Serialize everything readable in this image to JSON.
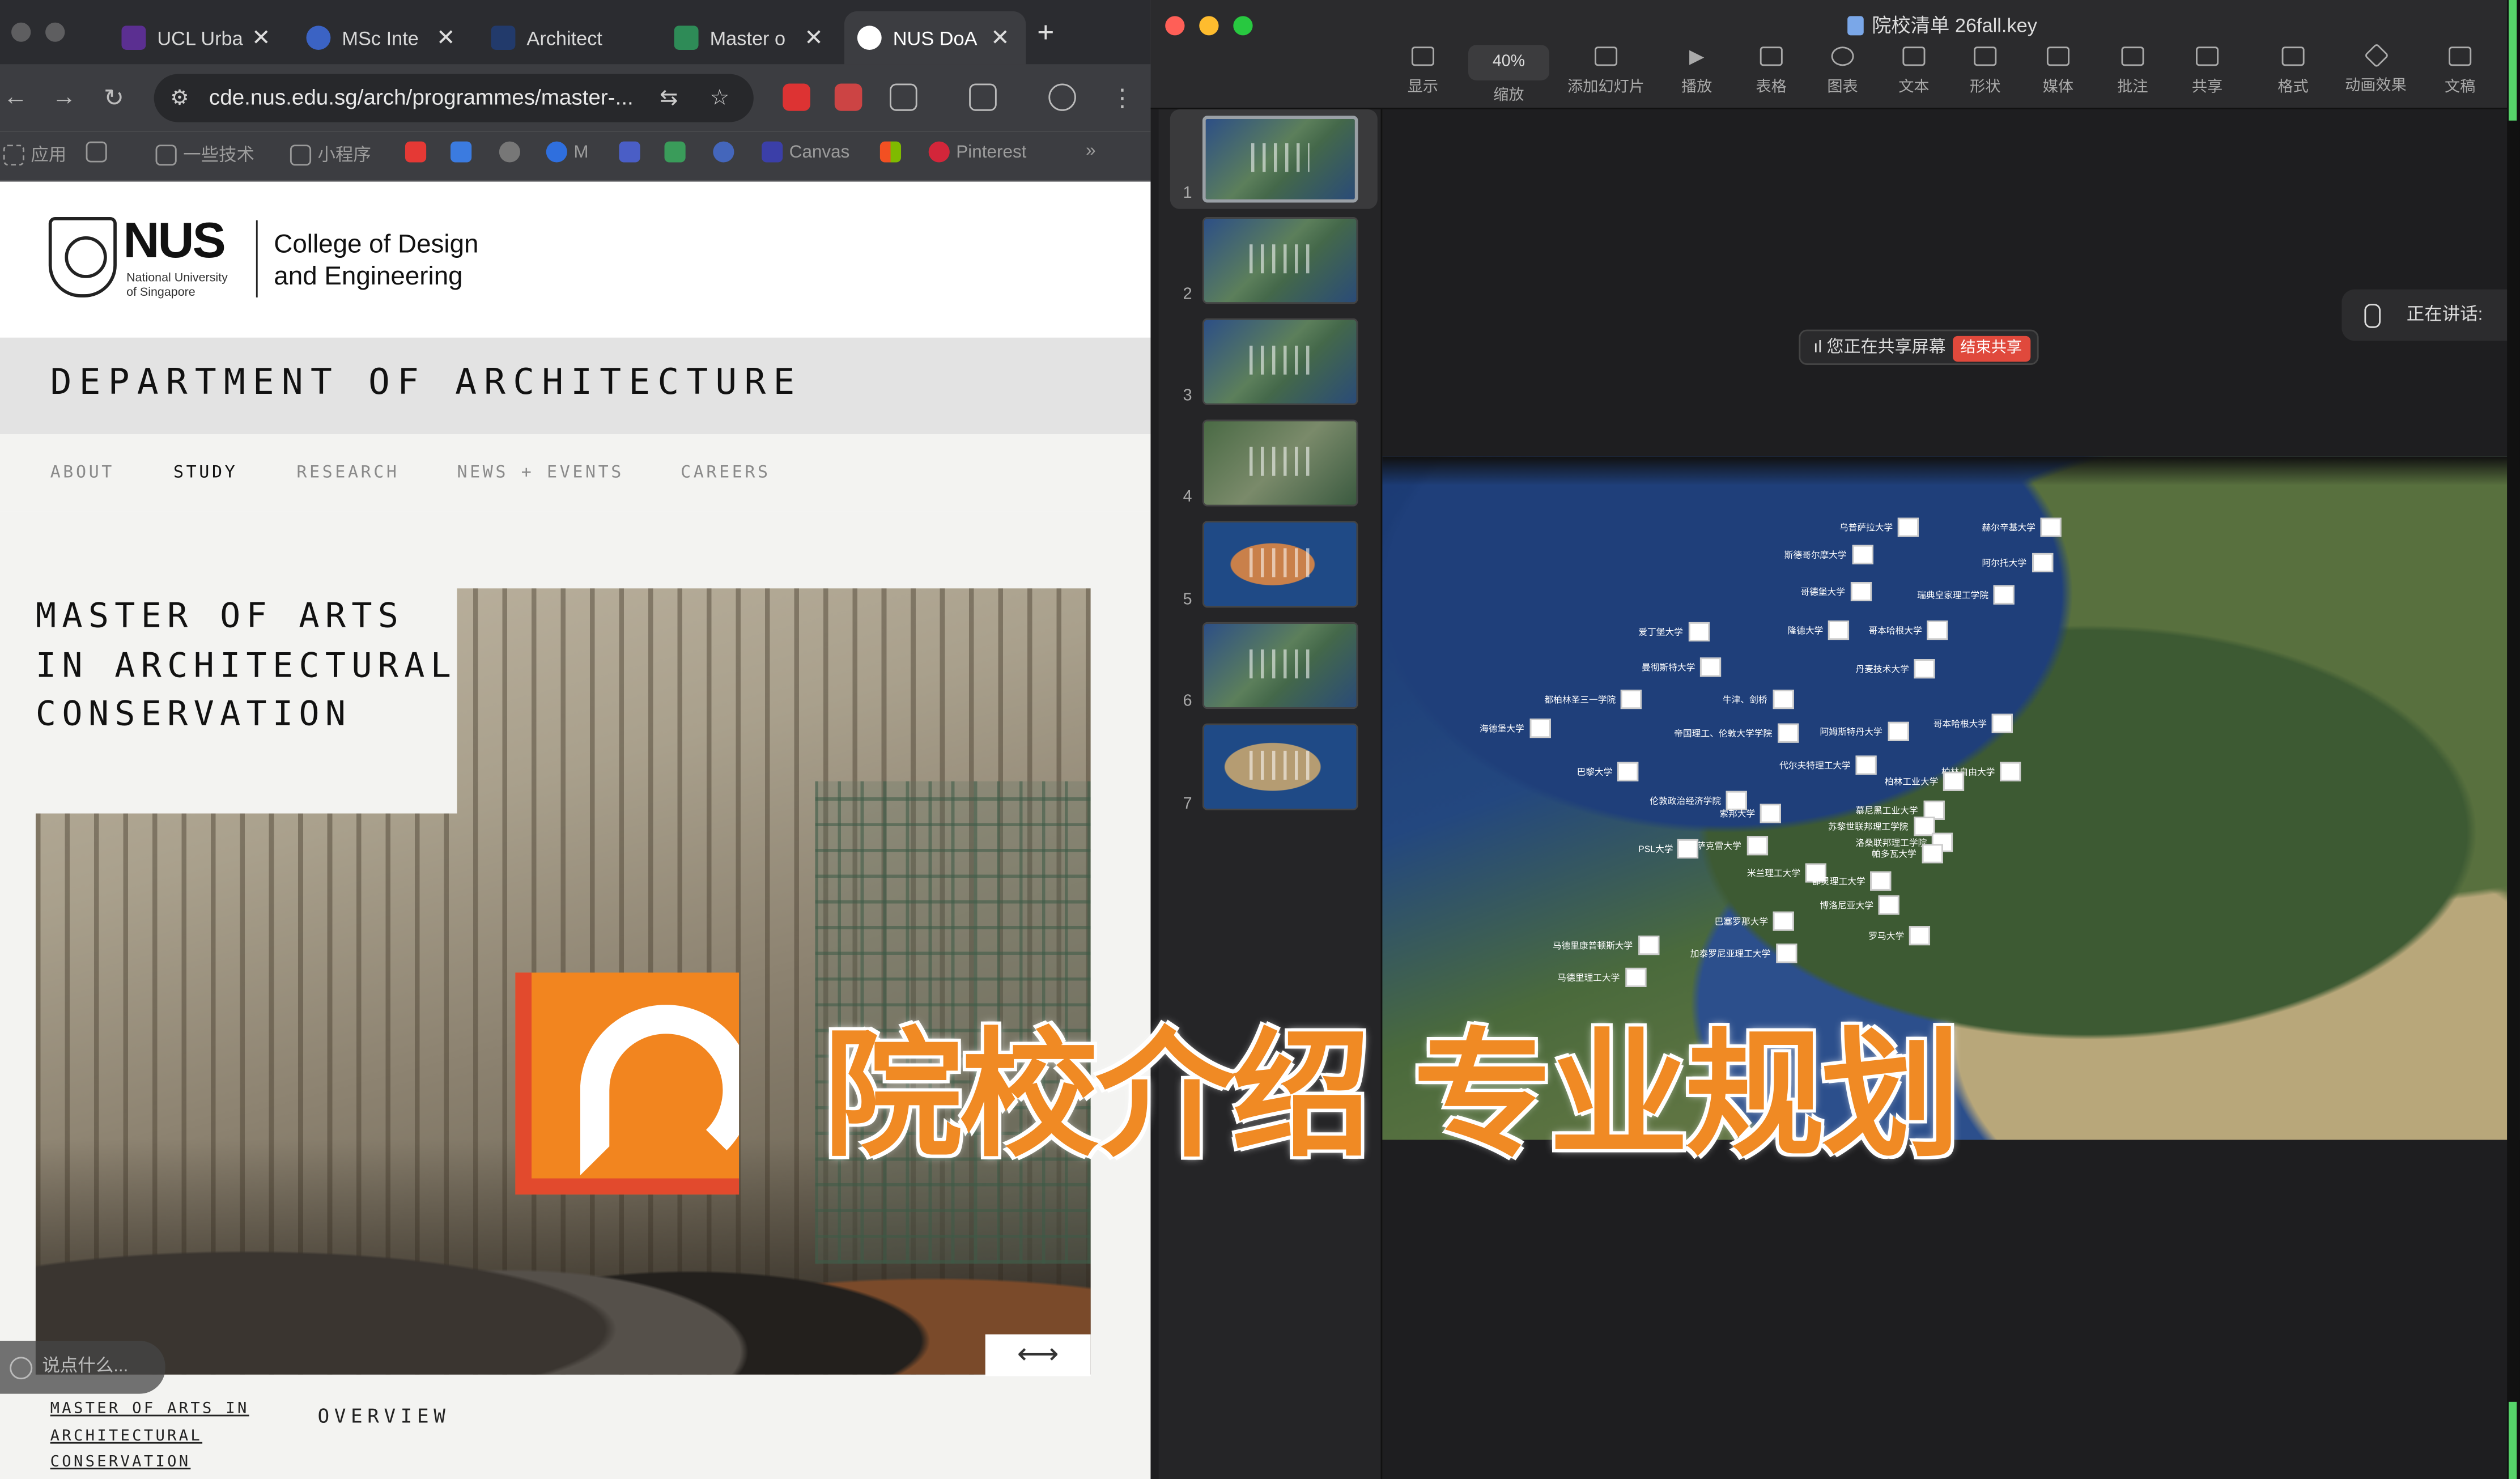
{
  "browser": {
    "tabs": [
      {
        "label": "UCL Urba",
        "close": "✕"
      },
      {
        "label": "MSc Inte",
        "close": "✕"
      },
      {
        "label": "Architect",
        "close": ""
      },
      {
        "label": "Master o",
        "close": "✕"
      },
      {
        "label": "NUS DoA",
        "close": "✕"
      }
    ],
    "new_tab": "+",
    "url": "cde.nus.edu.sg/arch/programmes/master-...",
    "bookmarks": [
      "应用",
      "一些技术",
      "小程序",
      "M",
      "Canvas",
      "Pinterest"
    ]
  },
  "site": {
    "logo_text": "NUS",
    "logo_sub": "National University of Singapore",
    "college_line1": "College of Design",
    "college_line2": "and Engineering",
    "department": "DEPARTMENT OF ARCHITECTURE",
    "menu": [
      "ABOUT",
      "STUDY",
      "RESEARCH",
      "NEWS + EVENTS",
      "CAREERS"
    ],
    "menu_active": "STUDY",
    "programme_title": "MASTER OF ARTS IN ARCHITECTURAL CONSERVATION",
    "arrow": "⟷",
    "chat_placeholder": "说点什么...",
    "side_link": "MASTER OF ARTS IN ARCHITECTURAL CONSERVATION",
    "section": "OVERVIEW"
  },
  "keynote": {
    "file_title": "院校清单 26fall.key",
    "zoom": "40%",
    "toolbar": [
      "显示",
      "缩放",
      "添加幻灯片",
      "播放",
      "表格",
      "图表",
      "文本",
      "形状",
      "媒体",
      "批注",
      "共享",
      "格式",
      "动画效果",
      "文稿"
    ],
    "slides": [
      "1",
      "2",
      "3",
      "4",
      "5",
      "6",
      "7"
    ],
    "share_status": "您正在共享屏幕",
    "end_share": "结束共享",
    "speaking": "正在讲话:",
    "map_labels": [
      "乌普萨拉大学",
      "赫尔辛基大学",
      "斯德哥尔摩大学",
      "阿尔托大学",
      "哥德堡大学",
      "瑞典皇家理工学院",
      "爱丁堡大学",
      "哥本哈根大学",
      "隆德大学",
      "曼彻斯特大学",
      "丹麦技术大学",
      "都柏林圣三一学院",
      "牛津、剑桥",
      "阿姆斯特丹大学",
      "哥本哈根大学",
      "海德堡大学",
      "帝国理工、伦敦大学学院",
      "代尔夫特理工大学",
      "巴黎大学",
      "柏林自由大学",
      "柏林工业大学",
      "伦敦政治经济学院",
      "慕尼黑工业大学",
      "索邦大学",
      "苏黎世联邦理工学院",
      "洛桑联邦理工学院",
      "巴黎萨克雷大学",
      "PSL大学",
      "巴塞罗那大学",
      "帕多瓦大学",
      "米兰理工大学",
      "都灵理工大学",
      "博洛尼亚大学",
      "马德里康普顿斯大学",
      "加泰罗尼亚理工大学",
      "马德里理工大学",
      "罗马大学"
    ]
  },
  "overlay": {
    "title": "院校介绍 专业规划"
  },
  "colors": {
    "accent_orange": "#f2851f",
    "accent_red": "#e24a2d",
    "end_share_red": "#e0493c"
  }
}
